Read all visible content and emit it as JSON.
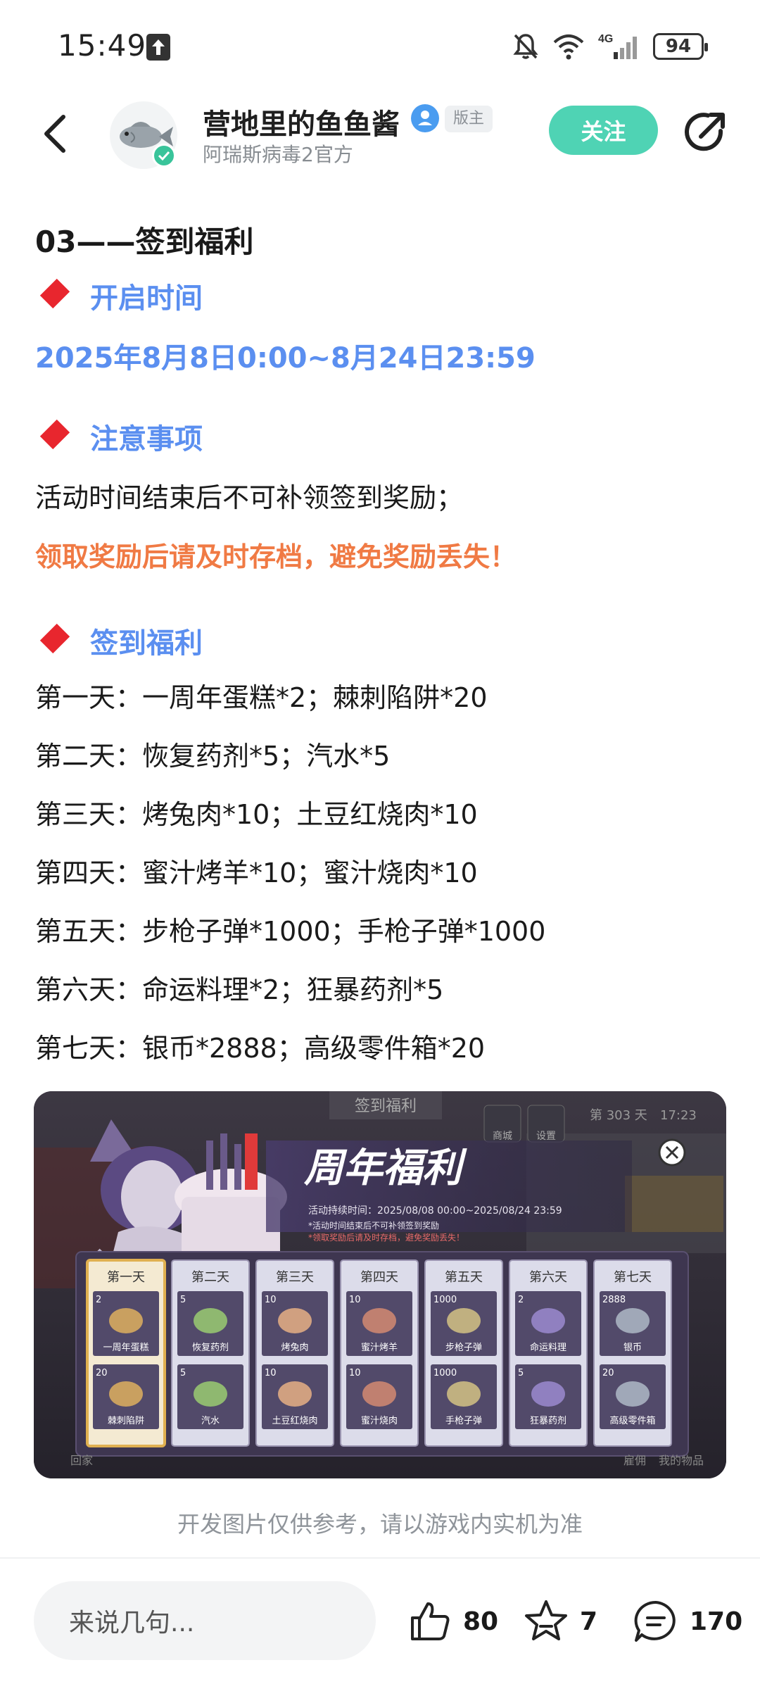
{
  "status": {
    "time": "15:49",
    "battery": "94",
    "network": "4G"
  },
  "header": {
    "author_name": "营地里的鱼鱼酱",
    "mod_badge": "版主",
    "author_sub": "阿瑞斯病毒2官方",
    "follow_label": "关注"
  },
  "article": {
    "title": "03——签到福利",
    "sections": {
      "time_label": "开启时间",
      "time_value": "2025年8月8日0:00~8月24日23:59",
      "notice_label": "注意事项",
      "notice_line1": "活动时间结束后不可补领签到奖励；",
      "notice_line2": "领取奖励后请及时存档，避免奖励丢失！",
      "reward_label": "签到福利"
    },
    "days": [
      "第一天：一周年蛋糕*2；棘刺陷阱*20",
      "第二天：恢复药剂*5；汽水*5",
      "第三天：烤兔肉*10；土豆红烧肉*10",
      "第四天：蜜汁烤羊*10；蜜汁烧肉*10",
      "第五天：步枪子弹*1000；手枪子弹*1000",
      "第六天：命运料理*2；狂暴药剂*5",
      "第七天：银币*2888；高级零件箱*20"
    ]
  },
  "game": {
    "top_sign": "签到福利",
    "top_shop": "商城",
    "top_settings": "设置",
    "day_counter": "第 303 天",
    "clock": "17:23",
    "banner_title": "周年福利",
    "duration": "活动持续时间：2025/08/08 00:00~2025/08/24 23:59",
    "note1": "*活动时间结束后不可补领签到奖励",
    "note2": "*领取奖励后请及时存档，避免奖励丢失！",
    "bottom_left": "回家",
    "bottom_right1": "雇佣",
    "bottom_right2": "我的物品",
    "days": [
      {
        "label": "第一天",
        "items": [
          {
            "qty": "2",
            "name": "一周年蛋糕"
          },
          {
            "qty": "20",
            "name": "棘刺陷阱"
          }
        ]
      },
      {
        "label": "第二天",
        "items": [
          {
            "qty": "5",
            "name": "恢复药剂"
          },
          {
            "qty": "5",
            "name": "汽水"
          }
        ]
      },
      {
        "label": "第三天",
        "items": [
          {
            "qty": "10",
            "name": "烤兔肉"
          },
          {
            "qty": "10",
            "name": "土豆红烧肉"
          }
        ]
      },
      {
        "label": "第四天",
        "items": [
          {
            "qty": "10",
            "name": "蜜汁烤羊"
          },
          {
            "qty": "10",
            "name": "蜜汁烧肉"
          }
        ]
      },
      {
        "label": "第五天",
        "items": [
          {
            "qty": "1000",
            "name": "步枪子弹"
          },
          {
            "qty": "1000",
            "name": "手枪子弹"
          }
        ]
      },
      {
        "label": "第六天",
        "items": [
          {
            "qty": "2",
            "name": "命运料理"
          },
          {
            "qty": "5",
            "name": "狂暴药剂"
          }
        ]
      },
      {
        "label": "第七天",
        "items": [
          {
            "qty": "2888",
            "name": "银币"
          },
          {
            "qty": "20",
            "name": "高级零件箱"
          }
        ]
      }
    ]
  },
  "caption": "开发图片仅供参考，请以游戏内实机为准",
  "bottom": {
    "comment_placeholder": "来说几句...",
    "likes": "80",
    "favorites": "7",
    "comments": "170"
  },
  "colors": {
    "accent_blue": "#5b8ff0",
    "warning_orange": "#f07a44",
    "follow_green": "#4fd3b4",
    "diamond_red": "#e8262e"
  }
}
